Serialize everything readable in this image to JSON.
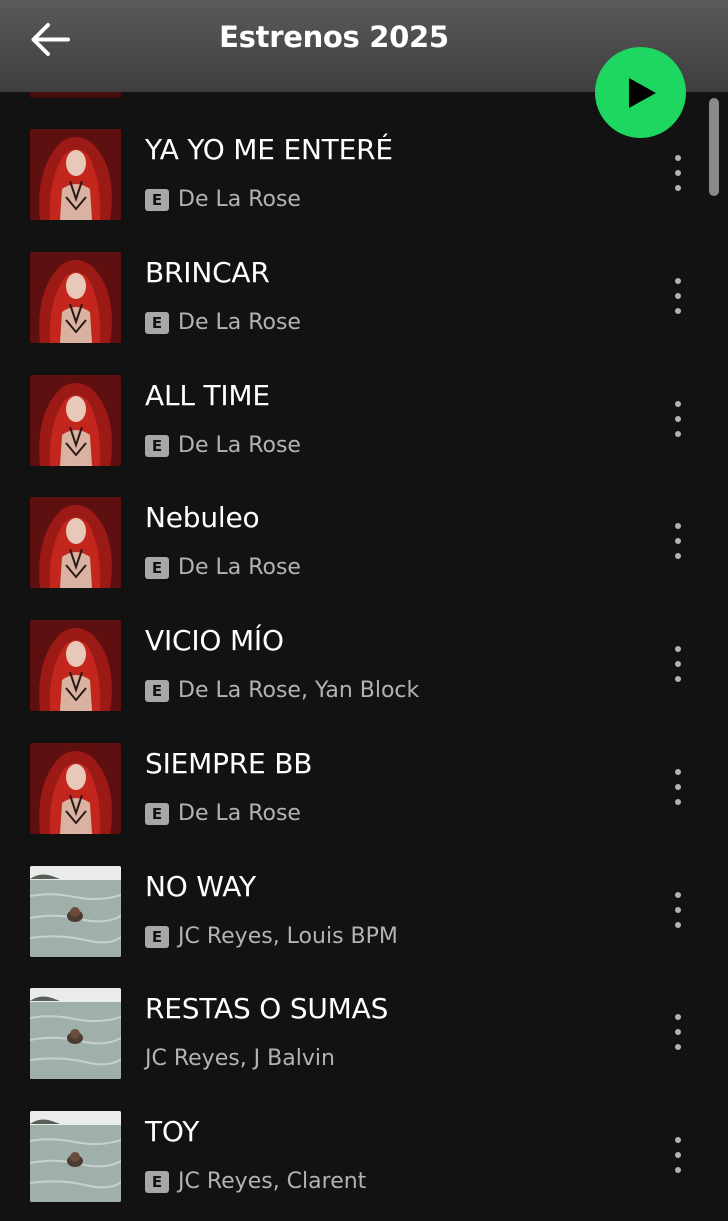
{
  "header": {
    "title": "Estrenos 2025"
  },
  "colors": {
    "accent": "#1ed760",
    "background": "#121212",
    "secondary_text": "#b3b3b3"
  },
  "icons": {
    "back": "arrow-left-icon",
    "play": "play-icon",
    "more": "more-vertical-icon"
  },
  "explicit_label": "E",
  "tracks": [
    {
      "title": "YA YO ME ENTERÉ",
      "artists": "De La Rose",
      "explicit": true,
      "cover": "red-hair-portrait"
    },
    {
      "title": "BRINCAR",
      "artists": "De La Rose",
      "explicit": true,
      "cover": "red-hair-portrait"
    },
    {
      "title": "ALL TIME",
      "artists": "De La Rose",
      "explicit": true,
      "cover": "red-hair-portrait"
    },
    {
      "title": "Nebuleo",
      "artists": "De La Rose",
      "explicit": true,
      "cover": "red-hair-portrait"
    },
    {
      "title": "VICIO MÍO",
      "artists": "De La Rose, Yan Block",
      "explicit": true,
      "cover": "red-hair-portrait"
    },
    {
      "title": "SIEMPRE BB",
      "artists": "De La Rose",
      "explicit": true,
      "cover": "red-hair-portrait"
    },
    {
      "title": "NO WAY",
      "artists": "JC Reyes, Louis BPM",
      "explicit": true,
      "cover": "sea-swimmer"
    },
    {
      "title": "RESTAS O SUMAS",
      "artists": "JC Reyes, J Balvin",
      "explicit": false,
      "cover": "sea-swimmer"
    },
    {
      "title": "TOY",
      "artists": "JC Reyes, Clarent",
      "explicit": true,
      "cover": "sea-swimmer"
    }
  ]
}
